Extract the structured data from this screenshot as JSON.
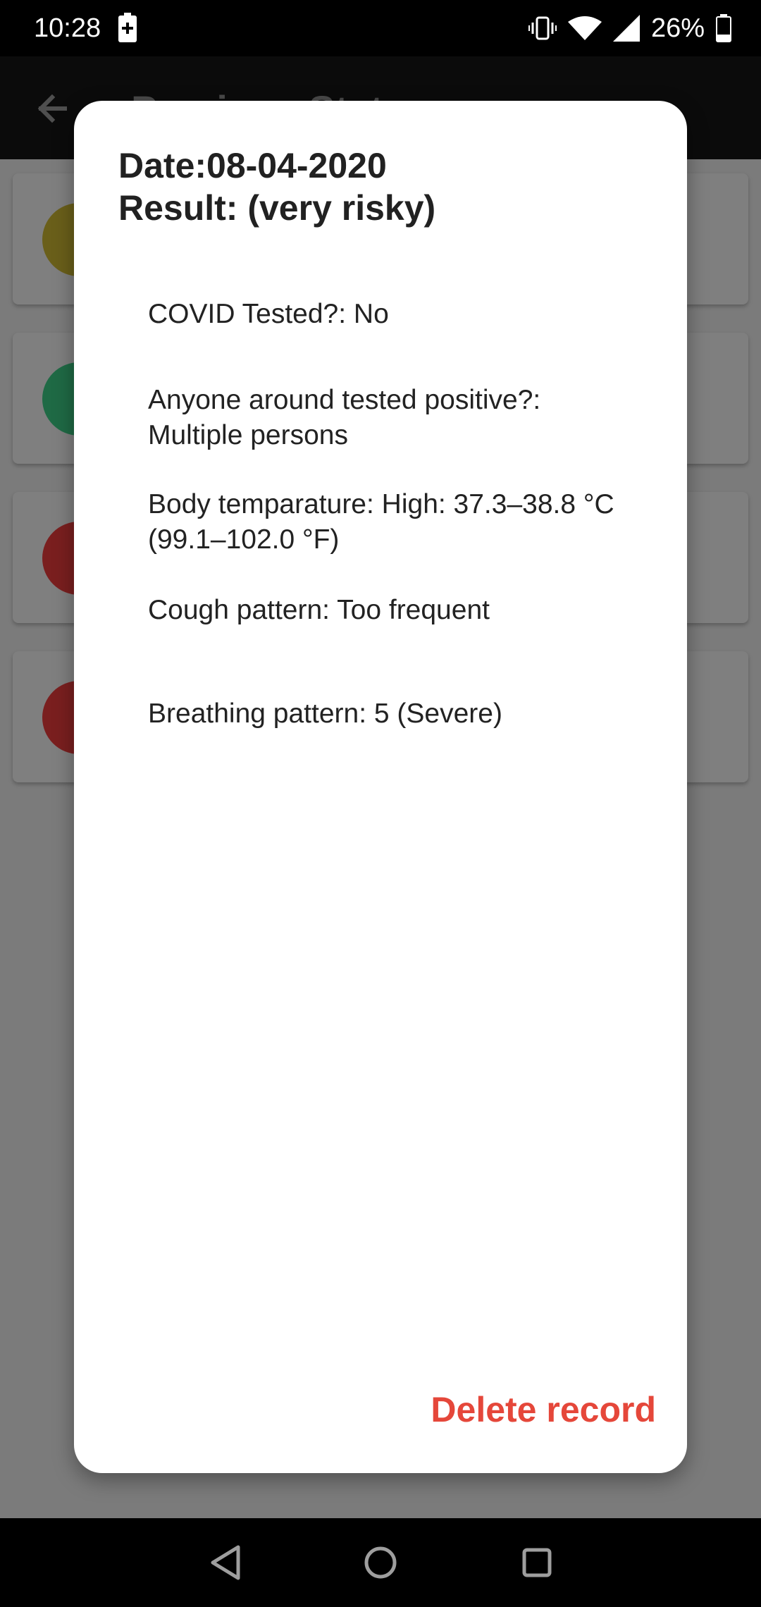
{
  "status_bar": {
    "time": "10:28",
    "battery_percent": "26%",
    "icons": [
      "battery-charging-icon",
      "vibrate-icon",
      "wifi-icon",
      "cell-signal-icon",
      "battery-icon"
    ]
  },
  "app_bar": {
    "title": "Previous Status"
  },
  "background_cards": [
    {
      "dot_color": "#6a5f1a"
    },
    {
      "dot_color": "#1f6a45"
    },
    {
      "dot_color": "#7a1f1f"
    },
    {
      "dot_color": "#7a1f1f"
    }
  ],
  "dialog": {
    "date_line": "Date:08-04-2020",
    "result_line": "Result: (very risky)",
    "fields": {
      "covid_tested": "COVID Tested?: No",
      "anyone_positive": "Anyone around tested positive?: Multiple persons",
      "body_temperature": "Body temparature: High: 37.3–38.8 °C (99.1–102.0 °F)",
      "cough_pattern": "Cough pattern: Too frequent",
      "breathing_pattern": "Breathing pattern: 5 (Severe)"
    },
    "delete_label": "Delete record",
    "delete_color": "#e5473a"
  },
  "nav_bar": {
    "icons": [
      "back-icon",
      "home-icon",
      "recents-icon"
    ]
  }
}
